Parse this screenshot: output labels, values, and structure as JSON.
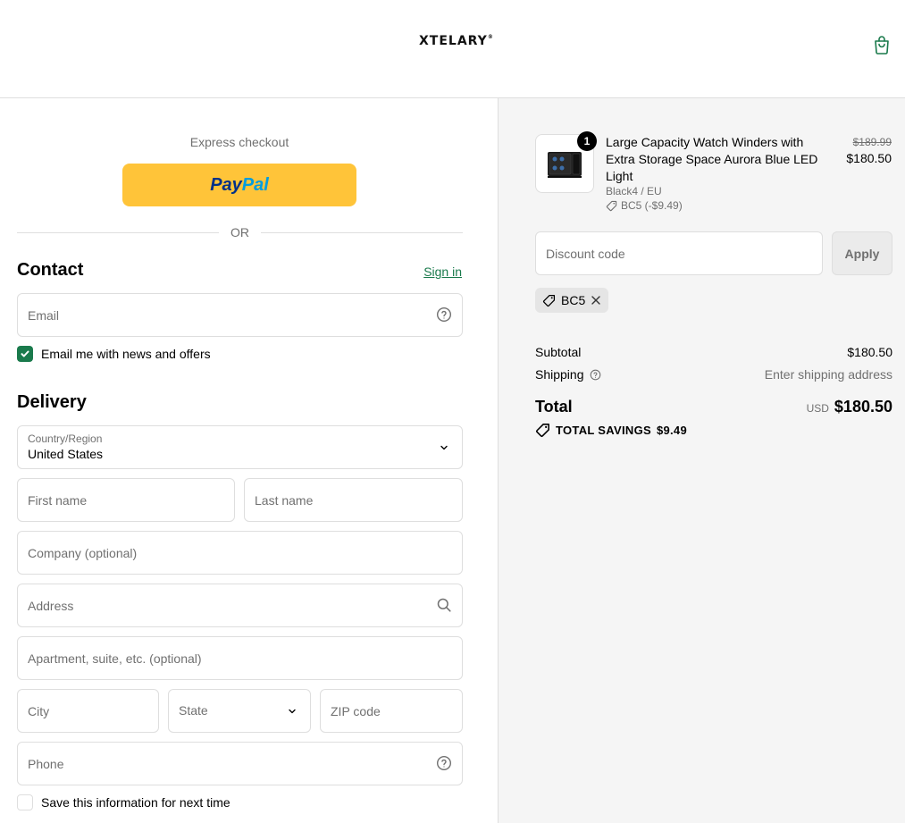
{
  "header": {
    "logo_text": "XTELARY",
    "logo_mark": "®",
    "cart_icon": "shopping-bag-icon"
  },
  "express": {
    "label": "Express checkout",
    "paypal_part1": "Pay",
    "paypal_part2": "Pal",
    "or_text": "OR"
  },
  "contact": {
    "title": "Contact",
    "sign_in": "Sign in",
    "email_placeholder": "Email",
    "email_offers_label": "Email me with news and offers",
    "email_offers_checked": true
  },
  "delivery": {
    "title": "Delivery",
    "country_label": "Country/Region",
    "country_value": "United States",
    "first_name_placeholder": "First name",
    "last_name_placeholder": "Last name",
    "company_placeholder": "Company (optional)",
    "address_placeholder": "Address",
    "apartment_placeholder": "Apartment, suite, etc. (optional)",
    "city_placeholder": "City",
    "state_placeholder": "State",
    "zip_placeholder": "ZIP code",
    "phone_placeholder": "Phone",
    "save_info_label": "Save this information for next time",
    "save_info_checked": false
  },
  "order": {
    "quantity": "1",
    "product_name": "Large Capacity Watch Winders with Extra Storage Space Aurora Blue LED Light",
    "variant": "Black4 / EU",
    "item_discount": "BC5 (-$9.49)",
    "original_price": "$189.99",
    "price": "$180.50",
    "discount_placeholder": "Discount code",
    "apply_label": "Apply",
    "applied_code": "BC5",
    "subtotal_label": "Subtotal",
    "subtotal_value": "$180.50",
    "shipping_label": "Shipping",
    "shipping_value": "Enter shipping address",
    "total_label": "Total",
    "currency": "USD",
    "total_value": "$180.50",
    "savings_label": "TOTAL SAVINGS",
    "savings_value": "$9.49"
  },
  "colors": {
    "accent": "#1a7a4c",
    "paypal_yellow": "#ffc439",
    "paypal_dark_blue": "#003087",
    "paypal_light_blue": "#009cde",
    "muted_text": "#707070",
    "border": "#dedede",
    "summary_bg": "#f5f5f5"
  }
}
